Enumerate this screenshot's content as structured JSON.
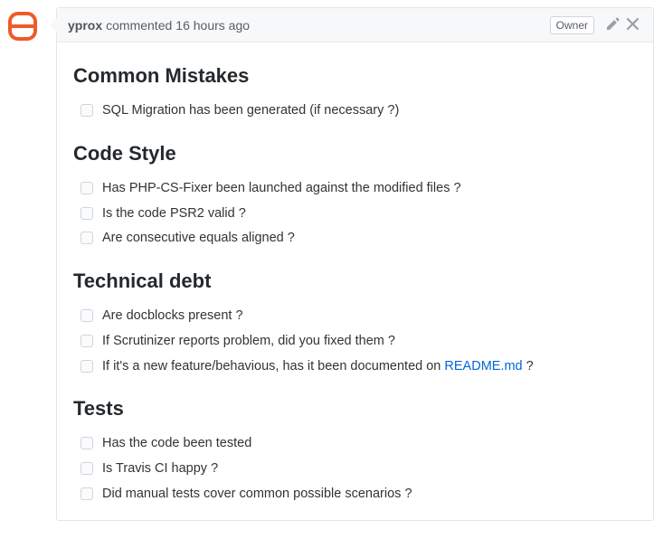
{
  "header": {
    "author": "yprox",
    "verb": "commented",
    "time": "16 hours ago",
    "owner_label": "Owner"
  },
  "sections": [
    {
      "title": "Common Mistakes",
      "items": [
        {
          "text": "SQL Migration has been generated (if necessary ?)"
        }
      ]
    },
    {
      "title": "Code Style",
      "items": [
        {
          "text": "Has PHP-CS-Fixer been launched against the modified files ?"
        },
        {
          "text": "Is the code PSR2 valid ?"
        },
        {
          "text": "Are consecutive equals aligned ?"
        }
      ]
    },
    {
      "title": "Technical debt",
      "items": [
        {
          "text": "Are docblocks present ?"
        },
        {
          "text": "If Scrutinizer reports problem, did you fixed them ?"
        },
        {
          "text_before": "If it's a new feature/behavious, has it been documented on ",
          "link_text": "README.md",
          "text_after": " ?"
        }
      ]
    },
    {
      "title": "Tests",
      "items": [
        {
          "text": "Has the code been tested"
        },
        {
          "text": "Is Travis CI happy ?"
        },
        {
          "text": "Did manual tests cover common possible scenarios ?"
        }
      ]
    }
  ]
}
